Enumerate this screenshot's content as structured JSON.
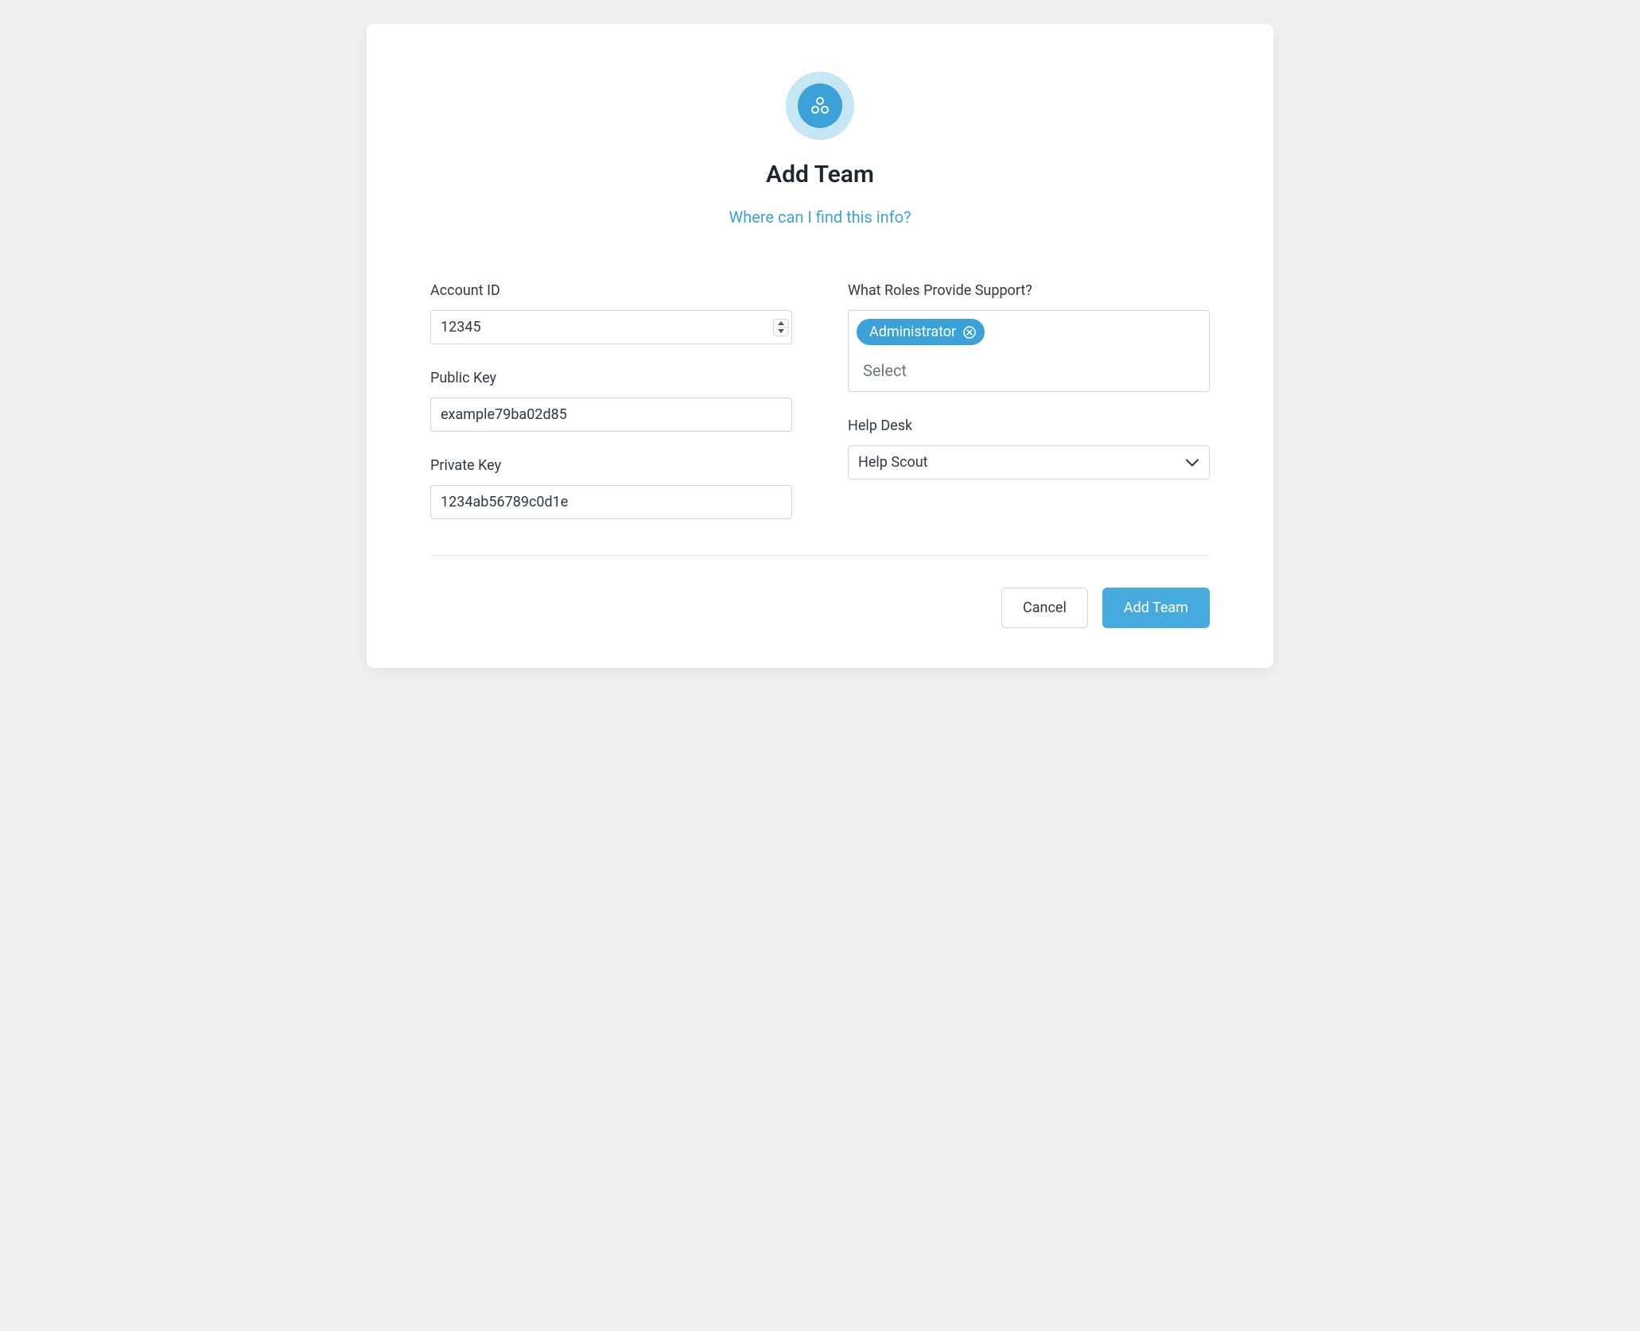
{
  "header": {
    "title": "Add Team",
    "help_link": "Where can I find this info?"
  },
  "form": {
    "account_id": {
      "label": "Account ID",
      "value": "12345"
    },
    "public_key": {
      "label": "Public Key",
      "value": "example79ba02d85"
    },
    "private_key": {
      "label": "Private Key",
      "value": "1234ab56789c0d1e"
    },
    "roles": {
      "label": "What Roles Provide Support?",
      "selected_tag": "Administrator",
      "placeholder": "Select"
    },
    "help_desk": {
      "label": "Help Desk",
      "value": "Help Scout"
    }
  },
  "footer": {
    "cancel": "Cancel",
    "submit": "Add Team"
  }
}
